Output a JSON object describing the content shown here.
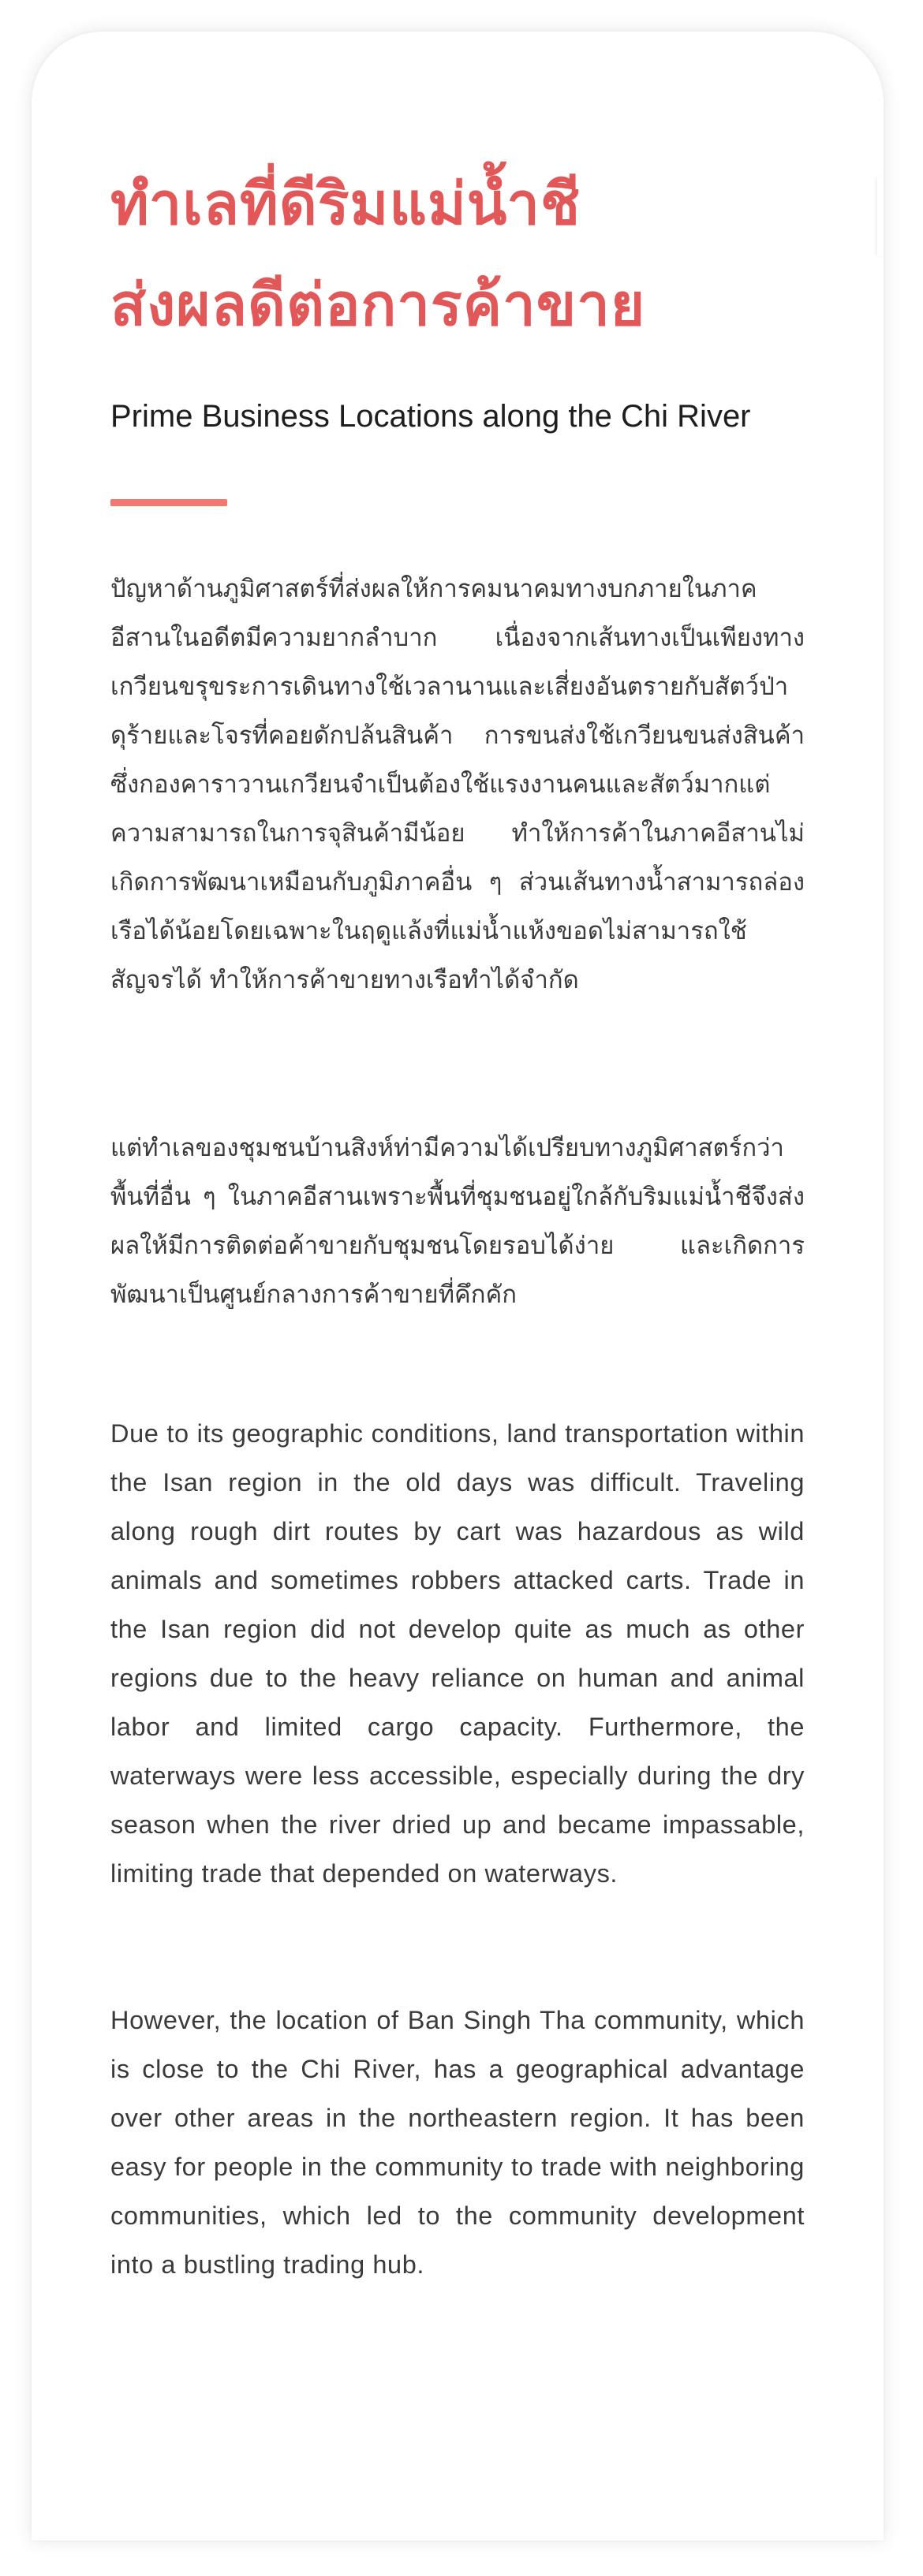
{
  "article": {
    "title_line1": "ทำเลที่ดีริมแม่น้ำชี",
    "title_line2": "ส่งผลดีต่อการค้าขาย",
    "subtitle": "Prime Business Locations along the Chi River",
    "paragraphs_th": [
      "ปัญหาด้านภูมิศาสตร์ที่ส่งผลให้การคมนาคมทางบกภายในภาคอีสานในอดีตมีความยากลำบาก เนื่องจากเส้นทางเป็นเพียงทางเกวียนขรุขระการเดินทางใช้เวลานานและเสี่ยงอันตรายกับสัตว์ป่าดุร้ายและโจรที่คอยดักปล้นสินค้า การขนส่งใช้เกวียนขนส่งสินค้า ซึ่งกองคาราวานเกวียนจำเป็นต้องใช้แรงงานคนและสัตว์มากแต่ความสามารถในการจุสินค้ามีน้อย ทำให้การค้าในภาคอีสานไม่เกิดการพัฒนาเหมือนกับภูมิภาคอื่น ๆ ส่วนเส้นทางน้ำสามารถล่องเรือได้น้อยโดยเฉพาะในฤดูแล้งที่แม่น้ำแห้งขอดไม่สามารถใช้สัญจรได้ ทำให้การค้าขายทางเรือทำได้จำกัด",
      "แต่ทำเลของชุมชนบ้านสิงห์ท่ามีความได้เปรียบทางภูมิศาสตร์กว่าพื้นที่อื่น ๆ ในภาคอีสานเพราะพื้นที่ชุมชนอยู่ใกล้กับริมแม่น้ำชีจึงส่งผลให้มีการติดต่อค้าขายกับชุมชนโดยรอบได้ง่าย และเกิดการพัฒนาเป็นศูนย์กลางการค้าขายที่คึกคัก"
    ],
    "paragraphs_en": [
      "Due to its geographic conditions, land transportation within the Isan region in the old days was difficult. Traveling along rough dirt routes by cart was hazardous as wild animals and sometimes robbers attacked carts. Trade in the Isan region did not develop quite as much as other regions due to the heavy reliance on human and animal labor and limited cargo capacity. Furthermore, the waterways were less accessible, especially during the dry season when the river dried up and became impassable, limiting trade that depended on waterways.",
      "However, the location of Ban Singh Tha community, which is close to the Chi River, has a geographical advantage over other areas in the northeastern region. It has been easy for people in the community to trade with neighboring communities, which led to the community development into a bustling trading hub."
    ]
  },
  "colors": {
    "title": "#e25858",
    "accent_rule": "#f07870",
    "body_text": "#3a3a3a",
    "subtitle_text": "#1e1e1e",
    "page_background": "#ffffff"
  }
}
